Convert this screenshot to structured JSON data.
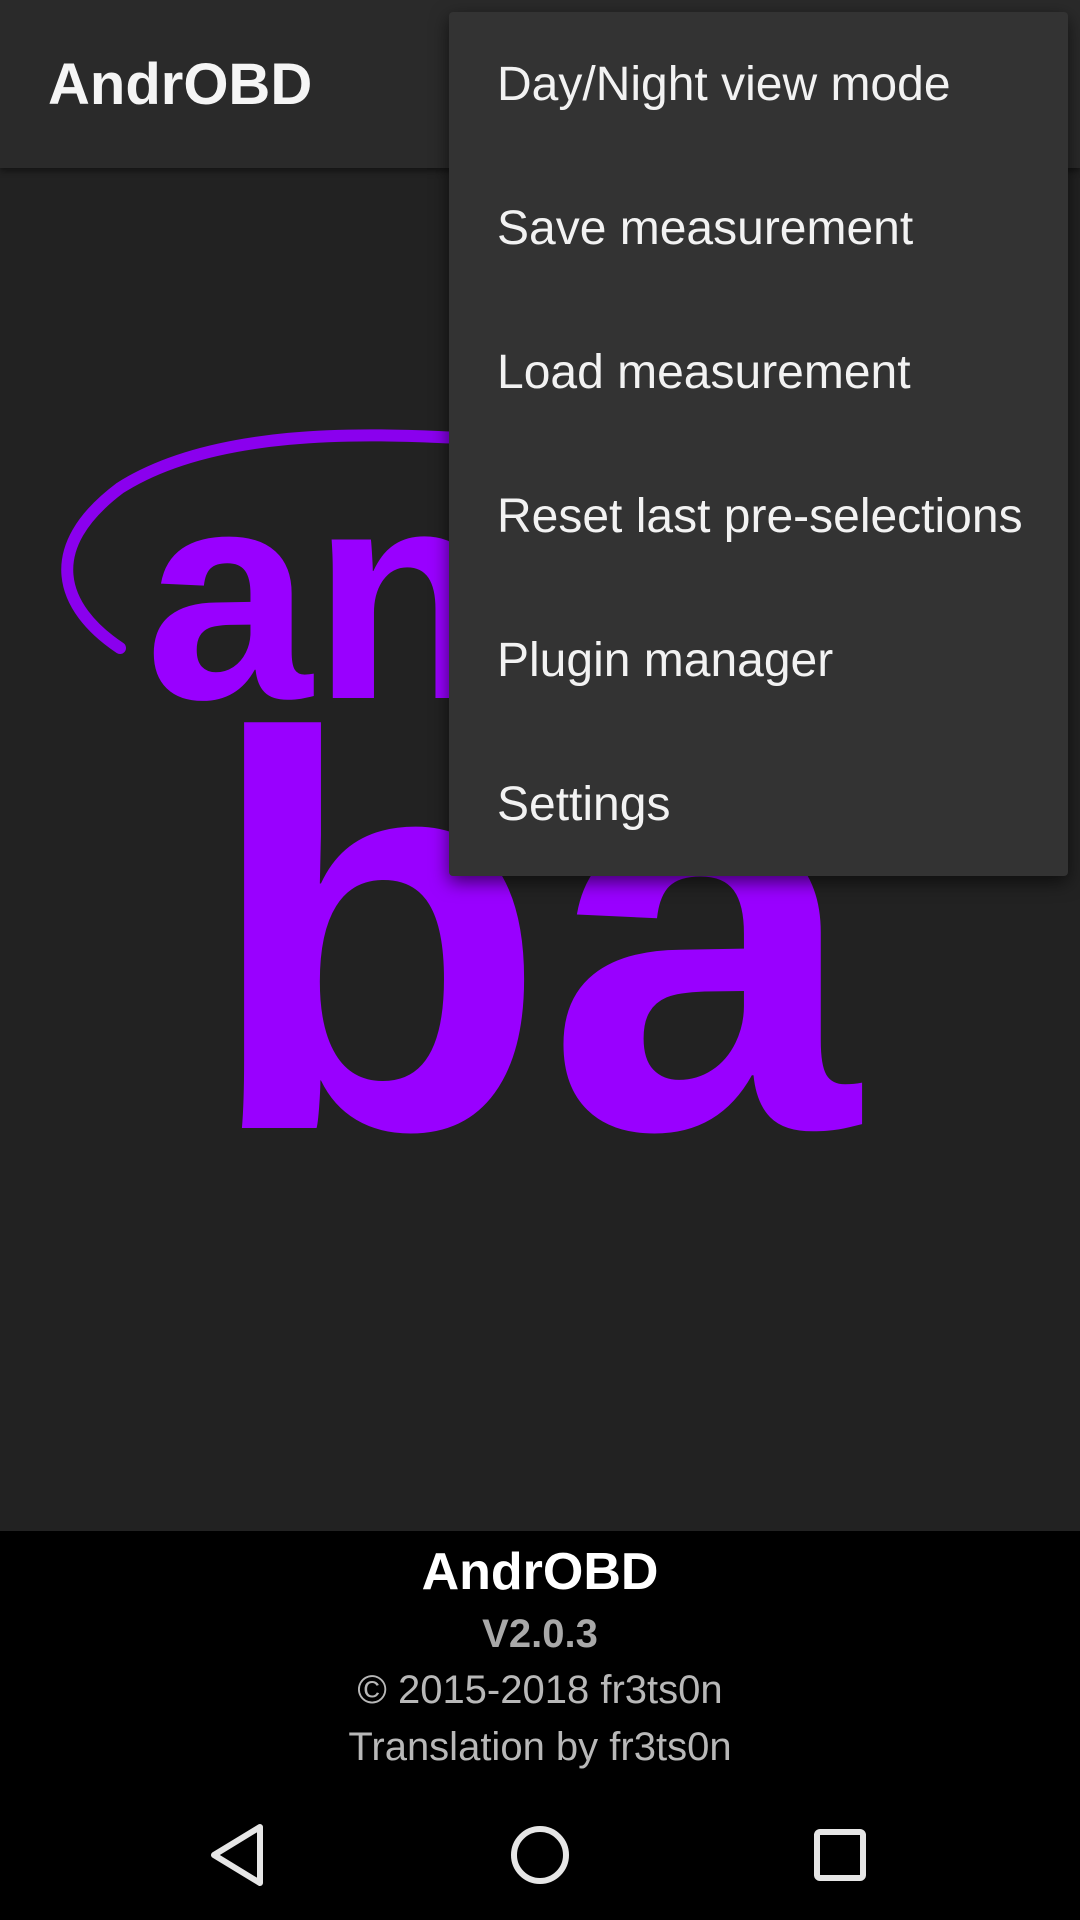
{
  "app_bar": {
    "title": "AndrOBD"
  },
  "logo": {
    "name": "androbd-logo",
    "color": "#9900ff"
  },
  "overflow_menu": {
    "items": [
      {
        "label": "Day/Night view mode"
      },
      {
        "label": "Save measurement"
      },
      {
        "label": "Load measurement"
      },
      {
        "label": "Reset last pre-selections"
      },
      {
        "label": "Plugin manager"
      },
      {
        "label": "Settings"
      }
    ]
  },
  "footer": {
    "app_name": "AndrOBD",
    "version": "V2.0.3",
    "copyright": "© 2015-2018 fr3ts0n",
    "translation": "Translation by fr3ts0n"
  },
  "nav_bar": {
    "buttons": [
      {
        "icon": "back-triangle-icon"
      },
      {
        "icon": "home-circle-icon"
      },
      {
        "icon": "recents-square-icon"
      }
    ]
  },
  "colors": {
    "background": "#222222",
    "app_bar": "#2a2a2a",
    "menu": "#333333",
    "footer": "#000000",
    "accent": "#9900ff"
  }
}
